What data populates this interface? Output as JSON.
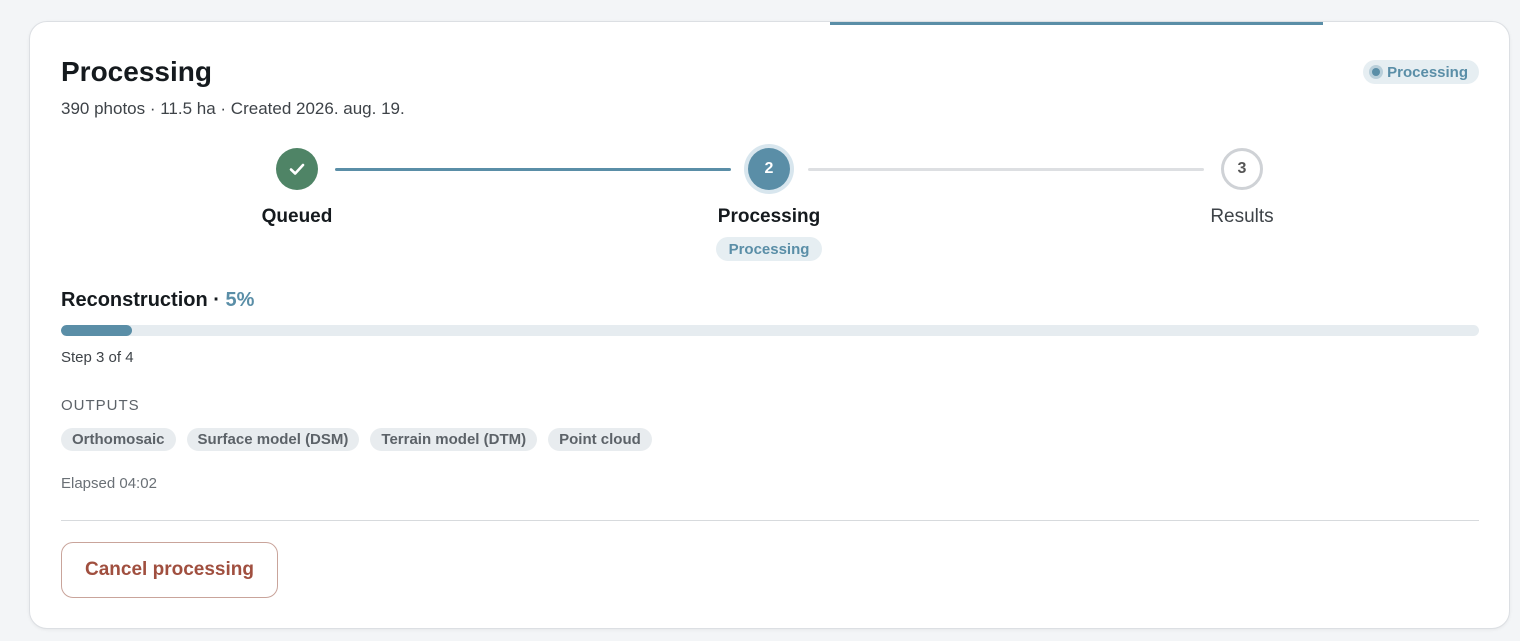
{
  "header": {
    "title": "Processing",
    "subtitle": "390 photos · 11.5 ha · Created 2026. aug. 19.",
    "status_label": "Processing"
  },
  "stepper": {
    "steps": [
      {
        "label": "Queued",
        "state": "done",
        "icon": "check-icon"
      },
      {
        "label": "Processing",
        "state": "active",
        "number": "2",
        "sub_badge": "Processing"
      },
      {
        "label": "Results",
        "state": "todo",
        "number": "3"
      }
    ]
  },
  "progress": {
    "stage": "Reconstruction",
    "separator": " · ",
    "percent_text": "5%",
    "percent_value": 5,
    "step_text": "Step 3 of 4"
  },
  "outputs": {
    "heading": "OUTPUTS",
    "items": [
      "Orthomosaic",
      "Surface model (DSM)",
      "Terrain model (DTM)",
      "Point cloud"
    ]
  },
  "elapsed": "Elapsed 04:02",
  "actions": {
    "cancel_label": "Cancel processing"
  },
  "colors": {
    "accent": "#5a8ea7",
    "success": "#4f8466",
    "danger": "#a04f3f"
  }
}
